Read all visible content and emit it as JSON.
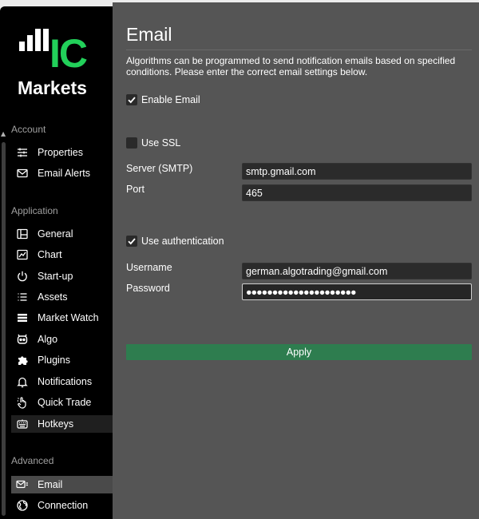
{
  "logo": {
    "brand_top": "IC",
    "brand_bottom": "Markets",
    "accent": "#22d05a"
  },
  "sidebar": {
    "sections": [
      {
        "label": "Account",
        "items": [
          {
            "label": "Properties",
            "icon": "sliders-icon"
          },
          {
            "label": "Email Alerts",
            "icon": "envelope-icon"
          }
        ]
      },
      {
        "label": "Application",
        "items": [
          {
            "label": "General",
            "icon": "layout-icon"
          },
          {
            "label": "Chart",
            "icon": "chart-icon"
          },
          {
            "label": "Start-up",
            "icon": "power-icon"
          },
          {
            "label": "Assets",
            "icon": "list-icon"
          },
          {
            "label": "Market Watch",
            "icon": "table-icon"
          },
          {
            "label": "Algo",
            "icon": "robot-icon"
          },
          {
            "label": "Plugins",
            "icon": "puzzle-icon"
          },
          {
            "label": "Notifications",
            "icon": "bell-icon"
          },
          {
            "label": "Quick Trade",
            "icon": "hand-pointer-icon"
          },
          {
            "label": "Hotkeys",
            "icon": "keyboard-icon"
          }
        ]
      },
      {
        "label": "Advanced",
        "items": [
          {
            "label": "Email",
            "icon": "email-settings-icon",
            "selected": true
          },
          {
            "label": "Connection",
            "icon": "globe-icon"
          }
        ]
      }
    ]
  },
  "main": {
    "title": "Email",
    "description": "Algorithms can be programmed to send notification emails based on specified conditions. Please enter the correct email settings below.",
    "enable_email": {
      "label": "Enable Email",
      "checked": true
    },
    "use_ssl": {
      "label": "Use SSL",
      "checked": false
    },
    "server": {
      "label": "Server (SMTP)",
      "value": "smtp.gmail.com"
    },
    "port": {
      "label": "Port",
      "value": "465"
    },
    "use_auth": {
      "label": "Use authentication",
      "checked": true
    },
    "username": {
      "label": "Username",
      "value": "german.algotrading@gmail.com"
    },
    "password": {
      "label": "Password",
      "value": "●●●●●●●●●●●●●●●●●●●●●"
    },
    "apply_label": "Apply",
    "apply_color": "#2e7d4f"
  }
}
